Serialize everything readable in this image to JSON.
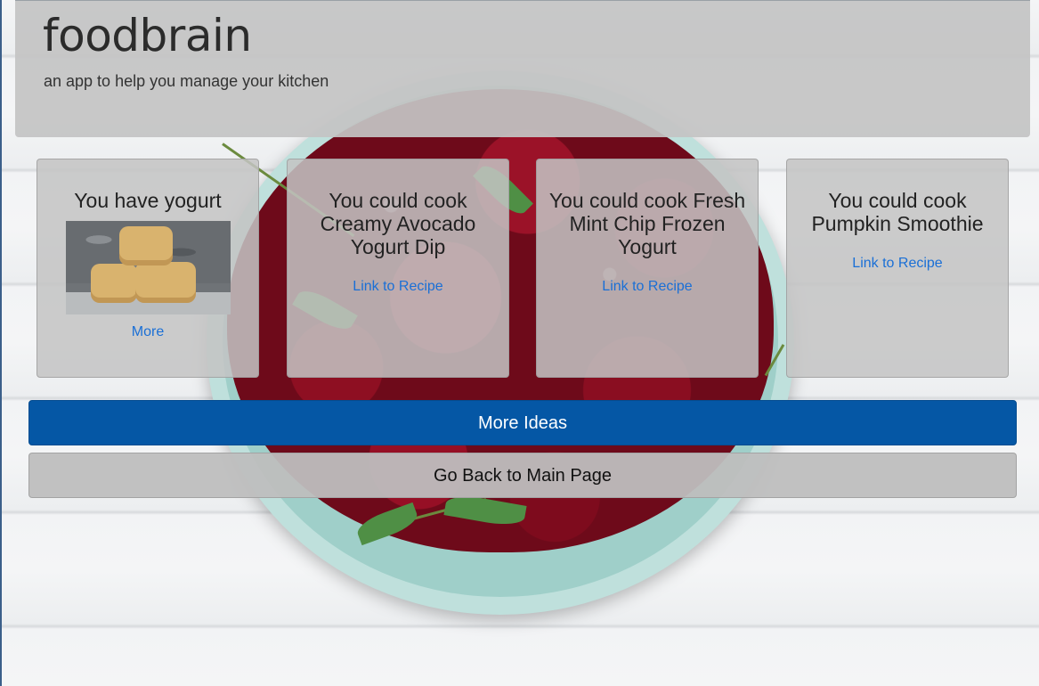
{
  "header": {
    "title": "foodbrain",
    "subtitle": "an app to help you manage your kitchen"
  },
  "cards": [
    {
      "title": "You have yogurt",
      "link_label": "More",
      "image": "cheese-wheels-photo"
    },
    {
      "title": "You could cook Creamy Avocado Yogurt Dip",
      "link_label": "Link to Recipe"
    },
    {
      "title": "You could cook Fresh Mint Chip Frozen Yogurt",
      "link_label": "Link to Recipe"
    },
    {
      "title": "You could cook Pumpkin Smoothie",
      "link_label": "Link to Recipe"
    }
  ],
  "buttons": {
    "more_ideas": "More Ideas",
    "go_back": "Go Back to Main Page"
  },
  "colors": {
    "primary_button": "#0557a5",
    "link": "#1a6fd6",
    "panel": "#c4c4c4"
  }
}
